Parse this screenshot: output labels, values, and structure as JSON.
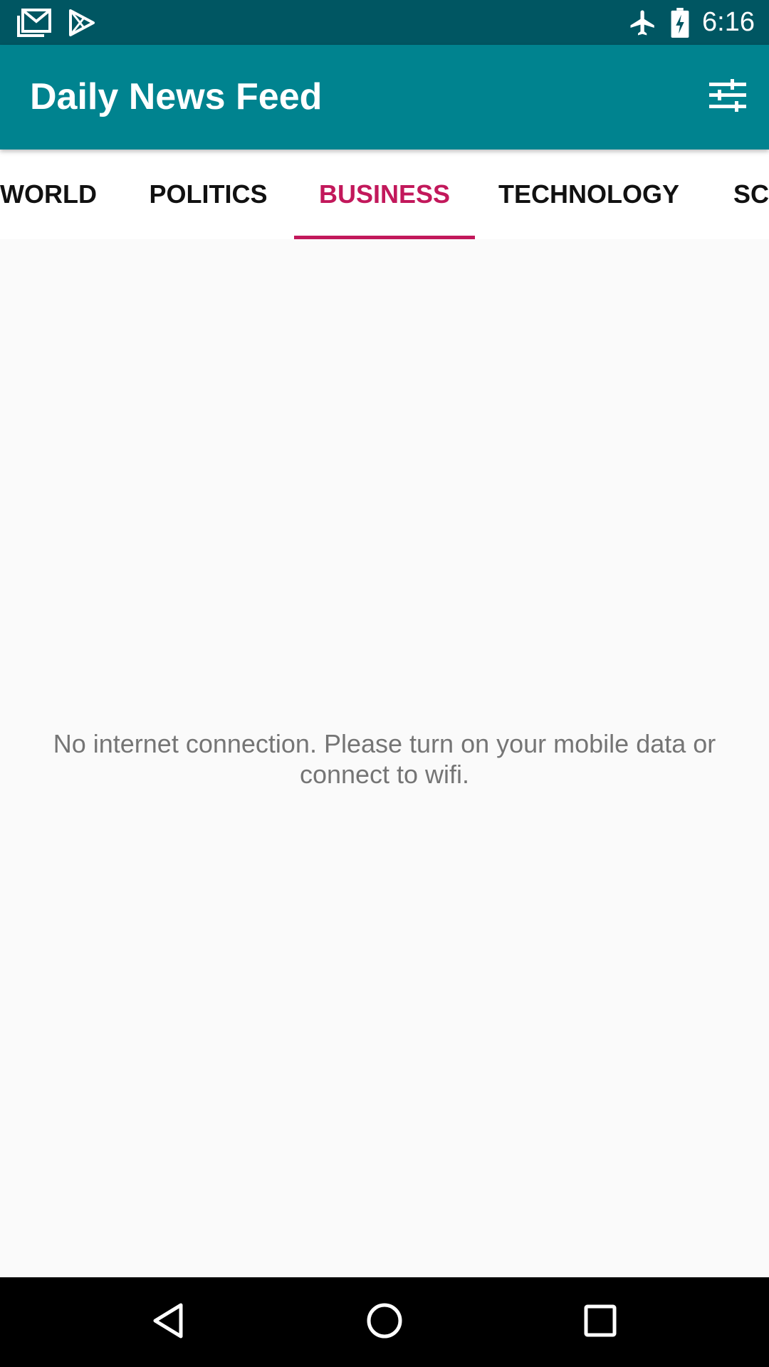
{
  "status_bar": {
    "time": "6:16",
    "left_icons": [
      "gmail-icon",
      "play-store-icon"
    ],
    "right_icons": [
      "airplane-mode-icon",
      "battery-charging-icon"
    ]
  },
  "app_bar": {
    "title": "Daily News Feed",
    "action_icon": "filter-sliders-icon"
  },
  "tabs": [
    {
      "label": "WORLD",
      "active": false
    },
    {
      "label": "POLITICS",
      "active": false
    },
    {
      "label": "BUSINESS",
      "active": true
    },
    {
      "label": "TECHNOLOGY",
      "active": false
    },
    {
      "label": "SC",
      "active": false
    }
  ],
  "main": {
    "empty_message": "No internet connection. Please turn on your mobile data or connect to wifi."
  },
  "nav_bar": {
    "icons": [
      "back-icon",
      "home-icon",
      "recents-icon"
    ]
  },
  "colors": {
    "status_bar": "#005662",
    "app_bar": "#00838f",
    "accent": "#c2185b",
    "background": "#fafafa",
    "message_text": "#757575"
  }
}
